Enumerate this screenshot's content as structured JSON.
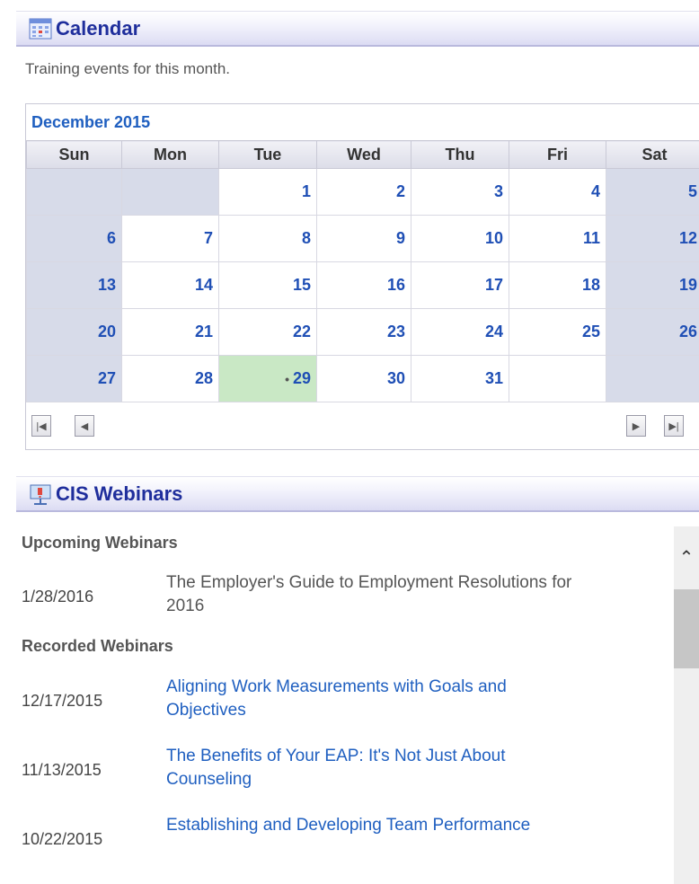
{
  "calendar_panel": {
    "title": "Calendar",
    "subtitle": "Training events for this month.",
    "month_label": "December 2015",
    "weekdays": [
      "Sun",
      "Mon",
      "Tue",
      "Wed",
      "Thu",
      "Fri",
      "Sat"
    ],
    "weeks": [
      [
        "",
        "",
        "1",
        "2",
        "3",
        "4",
        "5"
      ],
      [
        "6",
        "7",
        "8",
        "9",
        "10",
        "11",
        "12"
      ],
      [
        "13",
        "14",
        "15",
        "16",
        "17",
        "18",
        "19"
      ],
      [
        "20",
        "21",
        "22",
        "23",
        "24",
        "25",
        "26"
      ],
      [
        "27",
        "28",
        "29",
        "30",
        "31",
        "",
        ""
      ]
    ],
    "today": "29",
    "today_marker": "•",
    "colors": {
      "weekend": "#d7dbe9",
      "today": "#c9e8c5",
      "day_text": "#1f4fb5"
    },
    "nav": {
      "first_icon": "first-page-icon",
      "prev_icon": "prev-icon",
      "next_icon": "next-icon",
      "last_icon": "last-page-icon"
    }
  },
  "webinars_panel": {
    "title": "CIS Webinars",
    "upcoming_label": "Upcoming Webinars",
    "upcoming": [
      {
        "date": "1/28/2016",
        "title": "The Employer's Guide to Employment Resolutions for 2016"
      }
    ],
    "recorded_label": "Recorded Webinars",
    "recorded": [
      {
        "date": "12/17/2015",
        "title": "Aligning Work Measurements with Goals and Objectives"
      },
      {
        "date": "11/13/2015",
        "title": "The Benefits of Your EAP: It's Not Just About Counseling"
      },
      {
        "date": "10/22/2015",
        "title": "Establishing and Developing Team Performance"
      }
    ]
  },
  "colors": {
    "header_title": "#1f2e9c",
    "link": "#1f5fc0"
  }
}
